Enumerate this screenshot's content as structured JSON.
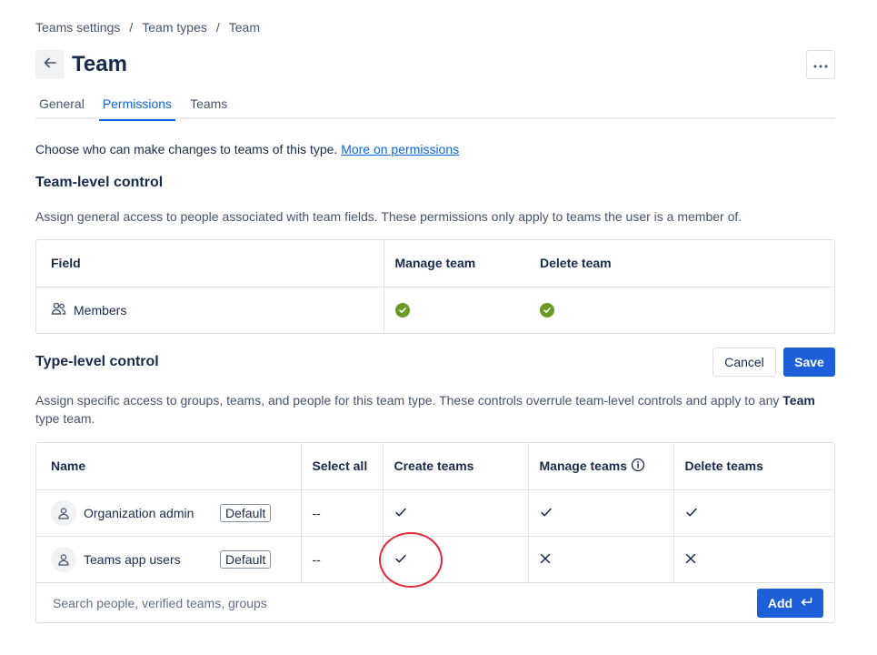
{
  "breadcrumb": [
    "Teams settings",
    "Team types",
    "Team"
  ],
  "breadcrumb_sep": "/",
  "page": {
    "title": "Team"
  },
  "tabs": [
    {
      "label": "General",
      "active": false
    },
    {
      "label": "Permissions",
      "active": true
    },
    {
      "label": "Teams",
      "active": false
    }
  ],
  "intro": {
    "text": "Choose who can make changes to teams of this type. ",
    "link": "More on permissions"
  },
  "team_level": {
    "title": "Team-level control",
    "description": "Assign general access to people associated with team fields. These permissions only apply to teams the user is a member of.",
    "columns": [
      "Field",
      "Manage team",
      "Delete team"
    ],
    "rows": [
      {
        "field": "Members",
        "icon": "people-icon",
        "manage": true,
        "delete": true
      }
    ]
  },
  "type_level": {
    "title": "Type-level control",
    "cancel_label": "Cancel",
    "save_label": "Save",
    "description_pre": "Assign specific access to groups, teams, and people for this team type. These controls overrule team-level controls and apply to any ",
    "description_bold": "Team",
    "description_post": " type team.",
    "columns": [
      "Name",
      "Select all",
      "Create teams",
      "Manage teams",
      "Delete teams"
    ],
    "rows": [
      {
        "name": "Organization admin",
        "badge": "Default",
        "select_all": "--",
        "create": "check",
        "manage": "check",
        "delete": "check"
      },
      {
        "name": "Teams app users",
        "badge": "Default",
        "select_all": "--",
        "create": "check",
        "manage": "cross",
        "delete": "cross"
      }
    ],
    "search_placeholder": "Search people, verified teams, groups",
    "add_label": "Add"
  },
  "colors": {
    "accent": "#0c66e4",
    "primary_button": "#1d5fd8",
    "success": "#6a9a23",
    "annotation": "#e0293b"
  }
}
